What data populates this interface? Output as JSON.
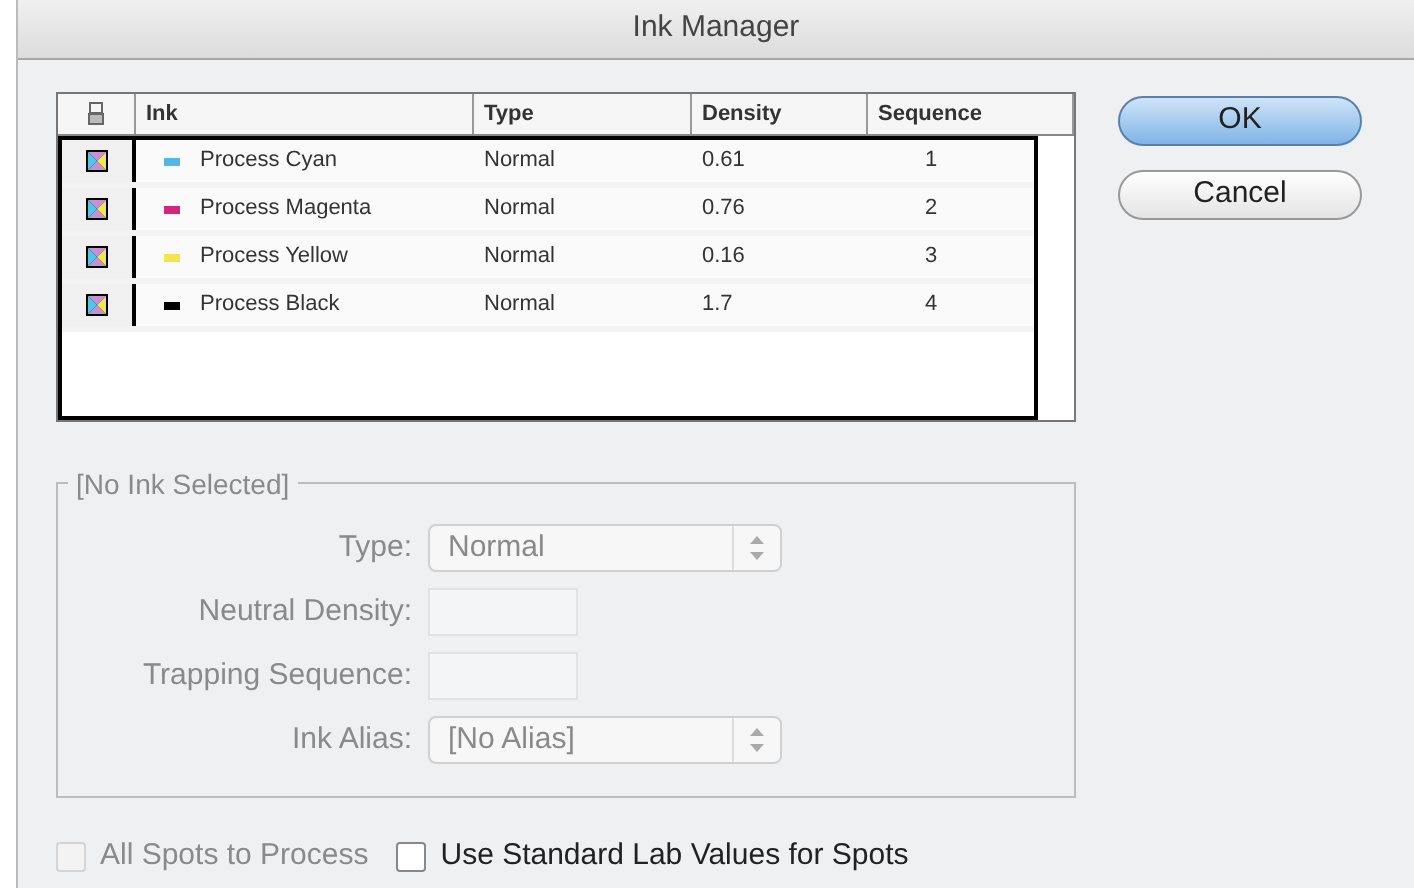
{
  "window": {
    "title": "Ink Manager"
  },
  "table": {
    "columns": [
      "Ink",
      "Type",
      "Density",
      "Sequence"
    ],
    "rows": [
      {
        "ink": "Process Cyan",
        "color": "#4fb8e6",
        "type": "Normal",
        "density": "0.61",
        "sequence": "1"
      },
      {
        "ink": "Process Magenta",
        "color": "#d6247e",
        "type": "Normal",
        "density": "0.76",
        "sequence": "2"
      },
      {
        "ink": "Process Yellow",
        "color": "#f2e64a",
        "type": "Normal",
        "density": "0.16",
        "sequence": "3"
      },
      {
        "ink": "Process Black",
        "color": "#000000",
        "type": "Normal",
        "density": "1.7",
        "sequence": "4"
      }
    ]
  },
  "buttons": [
    {
      "label": "OK",
      "kind": "default"
    },
    {
      "label": "Cancel",
      "kind": "normal"
    }
  ],
  "group": {
    "title": "[No Ink Selected]",
    "disabled": true,
    "fields": [
      {
        "kind": "select",
        "label": "Type:",
        "value": "Normal"
      },
      {
        "kind": "input",
        "label": "Neutral Density:"
      },
      {
        "kind": "input",
        "label": "Trapping Sequence:"
      },
      {
        "kind": "select",
        "label": "Ink Alias:",
        "value": "[No Alias]"
      }
    ]
  },
  "checkboxes": [
    {
      "label": "All Spots to Process",
      "checked": false,
      "disabled": true
    },
    {
      "label": "Use Standard Lab Values for Spots",
      "checked": false,
      "disabled": false
    }
  ]
}
